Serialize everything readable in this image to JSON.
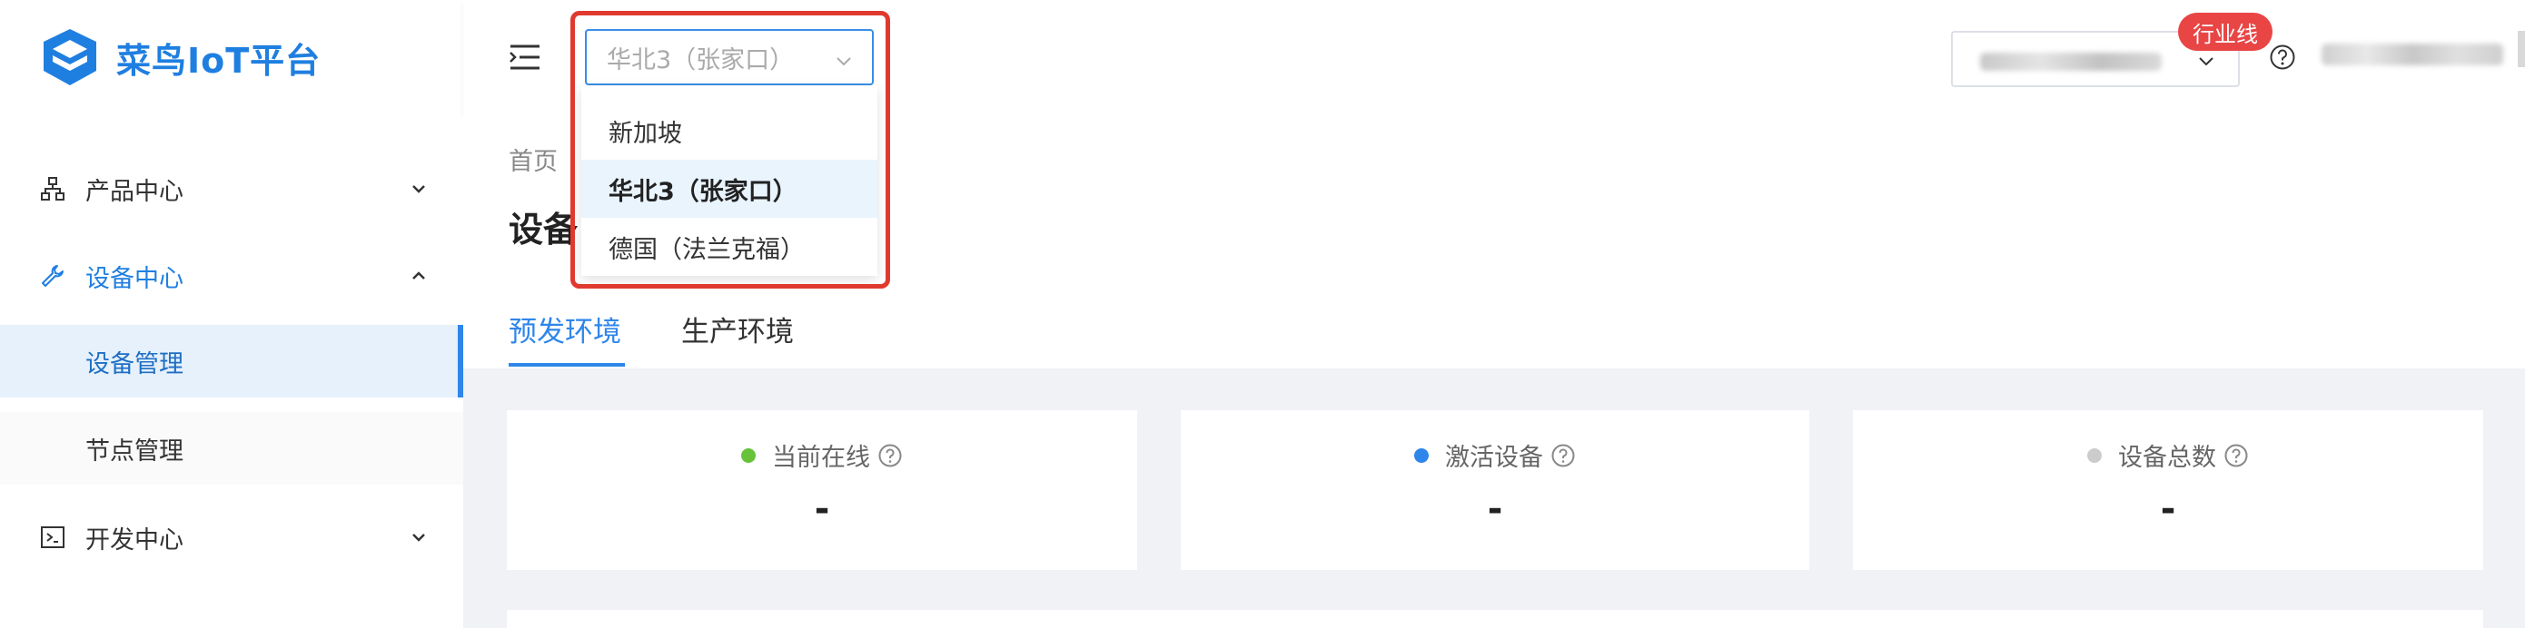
{
  "app": {
    "title": "菜鸟IoT平台",
    "brand_color": "#1f7fe0"
  },
  "sidebar": {
    "items": [
      {
        "label": "产品中心",
        "icon": "org-chart-icon",
        "expanded": false
      },
      {
        "label": "设备中心",
        "icon": "wrench-icon",
        "expanded": true,
        "children": [
          {
            "label": "设备管理",
            "active": true
          },
          {
            "label": "节点管理",
            "active": false
          }
        ]
      },
      {
        "label": "开发中心",
        "icon": "terminal-icon",
        "expanded": false
      }
    ]
  },
  "header": {
    "region_select": {
      "value": "华北3（张家口）"
    },
    "badge": "行业线"
  },
  "region_dropdown": {
    "options": [
      "新加坡",
      "华北3（张家口）",
      "德国（法兰克福）"
    ],
    "selected": "华北3（张家口）"
  },
  "content": {
    "breadcrumb": "首页",
    "page_title": "设备",
    "tabs": [
      {
        "label": "预发环境",
        "active": true
      },
      {
        "label": "生产环境",
        "active": false
      }
    ]
  },
  "stats": [
    {
      "label": "当前在线",
      "value": "-",
      "dot_color": "#67c23a"
    },
    {
      "label": "激活设备",
      "value": "-",
      "dot_color": "#2f86ea"
    },
    {
      "label": "设备总数",
      "value": "-",
      "dot_color": "#cccccc"
    }
  ]
}
